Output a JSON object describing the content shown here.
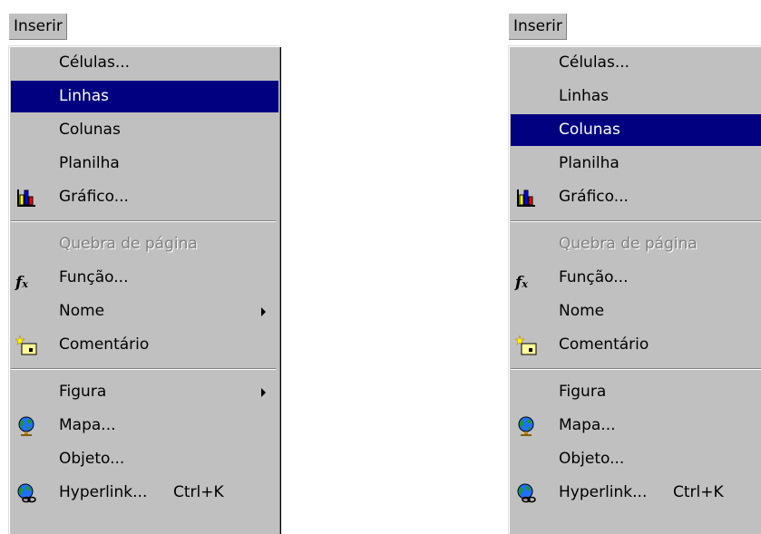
{
  "menus": [
    {
      "title": "Inserir",
      "items": [
        {
          "label": "Células...",
          "shortcut": "",
          "icon": "",
          "submenu": false,
          "highlighted": false,
          "disabled": false
        },
        {
          "label": "Linhas",
          "shortcut": "",
          "icon": "",
          "submenu": false,
          "highlighted": true,
          "disabled": false
        },
        {
          "label": "Colunas",
          "shortcut": "",
          "icon": "",
          "submenu": false,
          "highlighted": false,
          "disabled": false
        },
        {
          "label": "Planilha",
          "shortcut": "",
          "icon": "",
          "submenu": false,
          "highlighted": false,
          "disabled": false
        },
        {
          "label": "Gráfico...",
          "shortcut": "",
          "icon": "chart-icon",
          "submenu": false,
          "highlighted": false,
          "disabled": false
        },
        {
          "separator": true
        },
        {
          "label": "Quebra de página",
          "shortcut": "",
          "icon": "",
          "submenu": false,
          "highlighted": false,
          "disabled": true
        },
        {
          "label": "Função...",
          "shortcut": "",
          "icon": "function-icon",
          "submenu": false,
          "highlighted": false,
          "disabled": false
        },
        {
          "label": "Nome",
          "shortcut": "",
          "icon": "",
          "submenu": true,
          "highlighted": false,
          "disabled": false
        },
        {
          "label": "Comentário",
          "shortcut": "",
          "icon": "comment-icon",
          "submenu": false,
          "highlighted": false,
          "disabled": false
        },
        {
          "separator": true
        },
        {
          "label": "Figura",
          "shortcut": "",
          "icon": "",
          "submenu": true,
          "highlighted": false,
          "disabled": false
        },
        {
          "label": "Mapa...",
          "shortcut": "",
          "icon": "globe-icon",
          "submenu": false,
          "highlighted": false,
          "disabled": false
        },
        {
          "label": "Objeto...",
          "shortcut": "",
          "icon": "",
          "submenu": false,
          "highlighted": false,
          "disabled": false
        },
        {
          "label": "Hyperlink...",
          "shortcut": "Ctrl+K",
          "icon": "hyperlink-icon",
          "submenu": false,
          "highlighted": false,
          "disabled": false
        }
      ]
    },
    {
      "title": "Inserir",
      "items": [
        {
          "label": "Células...",
          "shortcut": "",
          "icon": "",
          "submenu": false,
          "highlighted": false,
          "disabled": false
        },
        {
          "label": "Linhas",
          "shortcut": "",
          "icon": "",
          "submenu": false,
          "highlighted": false,
          "disabled": false
        },
        {
          "label": "Colunas",
          "shortcut": "",
          "icon": "",
          "submenu": false,
          "highlighted": true,
          "disabled": false
        },
        {
          "label": "Planilha",
          "shortcut": "",
          "icon": "",
          "submenu": false,
          "highlighted": false,
          "disabled": false
        },
        {
          "label": "Gráfico...",
          "shortcut": "",
          "icon": "chart-icon",
          "submenu": false,
          "highlighted": false,
          "disabled": false
        },
        {
          "separator": true
        },
        {
          "label": "Quebra de página",
          "shortcut": "",
          "icon": "",
          "submenu": false,
          "highlighted": false,
          "disabled": true
        },
        {
          "label": "Função...",
          "shortcut": "",
          "icon": "function-icon",
          "submenu": false,
          "highlighted": false,
          "disabled": false
        },
        {
          "label": "Nome",
          "shortcut": "",
          "icon": "",
          "submenu": true,
          "highlighted": false,
          "disabled": false
        },
        {
          "label": "Comentário",
          "shortcut": "",
          "icon": "comment-icon",
          "submenu": false,
          "highlighted": false,
          "disabled": false
        },
        {
          "separator": true
        },
        {
          "label": "Figura",
          "shortcut": "",
          "icon": "",
          "submenu": true,
          "highlighted": false,
          "disabled": false
        },
        {
          "label": "Mapa...",
          "shortcut": "",
          "icon": "globe-icon",
          "submenu": false,
          "highlighted": false,
          "disabled": false
        },
        {
          "label": "Objeto...",
          "shortcut": "",
          "icon": "",
          "submenu": false,
          "highlighted": false,
          "disabled": false
        },
        {
          "label": "Hyperlink...",
          "shortcut": "Ctrl+K",
          "icon": "hyperlink-icon",
          "submenu": false,
          "highlighted": false,
          "disabled": false
        }
      ]
    }
  ],
  "colors": {
    "menu_bg": "#c0c0c0",
    "highlight_bg": "#000080",
    "highlight_text": "#ffffff",
    "disabled_text": "#808080"
  }
}
